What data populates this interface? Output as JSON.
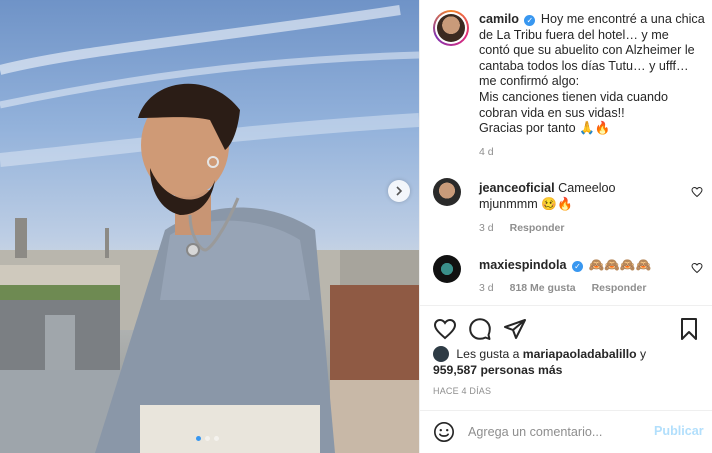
{
  "post": {
    "username": "camilo",
    "caption_lines": [
      "Hoy me encontré a una chica",
      "de La Tribu fuera del hotel… y me",
      "contó que su abuelito con Alzheimer le",
      "cantaba todos los días Tutu… y ufff…",
      "me confirmó algo:",
      "Mis canciones tienen vida cuando",
      "cobran vida en sus vidas!!",
      "Gracias por tanto 🙏🔥"
    ],
    "caption_first": "Hoy me encontré a una chica",
    "time": "4 d"
  },
  "comments": [
    {
      "username": "jeanceoficial",
      "text": "Cameeloo mjunmmm 🥴🔥",
      "time": "3 d",
      "likes": "",
      "reply": "Responder"
    },
    {
      "username": "maxiespindola",
      "text": "🙈🙈🙈🙈",
      "time": "3 d",
      "likes": "818 Me gusta",
      "reply": "Responder"
    }
  ],
  "likes": {
    "prefix": "Les gusta a",
    "first_user": "mariapaoladabalillo",
    "joiner": "y",
    "count": "959,587 personas más"
  },
  "posted": "HACE 4 DÍAS",
  "composer": {
    "placeholder": "Agrega un comentario...",
    "publish": "Publicar"
  },
  "icons": {
    "verified": "verified-badge-icon",
    "like": "heart-icon",
    "comment": "comment-icon",
    "share": "paper-plane-icon",
    "save": "bookmark-icon",
    "emoji": "smiley-icon",
    "next": "chevron-right-icon"
  },
  "colors": {
    "accent": "#3897f0",
    "publish_disabled": "#b2dffc",
    "muted": "#8e8e8e"
  },
  "carousel": {
    "slides": 3,
    "active": 1
  }
}
